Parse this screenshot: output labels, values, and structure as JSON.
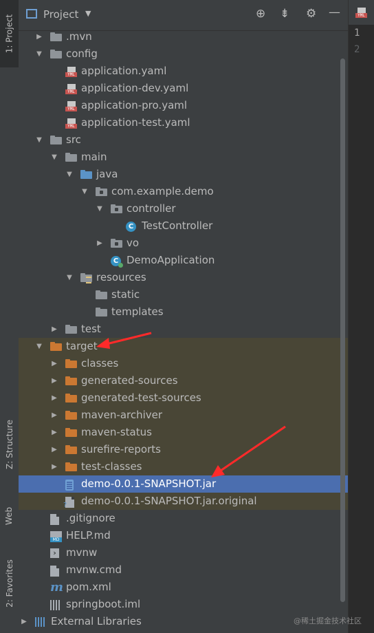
{
  "sidebar": {
    "project_tab": "1: Project",
    "structure_tab": "Z: Structure",
    "web_tab": "Web",
    "favorites_tab": "2: Favorites"
  },
  "header": {
    "title": "Project"
  },
  "tree": [
    {
      "label": ".mvn",
      "depth": 0,
      "arrow": "right",
      "icon": "folder-grey"
    },
    {
      "label": "config",
      "depth": 0,
      "arrow": "down",
      "icon": "folder-grey"
    },
    {
      "label": "application.yaml",
      "depth": 1,
      "arrow": "",
      "icon": "yaml-file"
    },
    {
      "label": "application-dev.yaml",
      "depth": 1,
      "arrow": "",
      "icon": "yaml-file"
    },
    {
      "label": "application-pro.yaml",
      "depth": 1,
      "arrow": "",
      "icon": "yaml-file"
    },
    {
      "label": "application-test.yaml",
      "depth": 1,
      "arrow": "",
      "icon": "yaml-file"
    },
    {
      "label": "src",
      "depth": 0,
      "arrow": "down",
      "icon": "folder-grey"
    },
    {
      "label": "main",
      "depth": 1,
      "arrow": "down",
      "icon": "folder-grey"
    },
    {
      "label": "java",
      "depth": 2,
      "arrow": "down",
      "icon": "folder-blue"
    },
    {
      "label": "com.example.demo",
      "depth": 3,
      "arrow": "down",
      "icon": "package"
    },
    {
      "label": "controller",
      "depth": 4,
      "arrow": "down",
      "icon": "package"
    },
    {
      "label": "TestController",
      "depth": 5,
      "arrow": "",
      "icon": "class"
    },
    {
      "label": "vo",
      "depth": 4,
      "arrow": "right",
      "icon": "package"
    },
    {
      "label": "DemoApplication",
      "depth": 4,
      "arrow": "",
      "icon": "spring-class"
    },
    {
      "label": "resources",
      "depth": 2,
      "arrow": "down",
      "icon": "resources-folder"
    },
    {
      "label": "static",
      "depth": 3,
      "arrow": "",
      "icon": "folder-grey"
    },
    {
      "label": "templates",
      "depth": 3,
      "arrow": "",
      "icon": "folder-grey"
    },
    {
      "label": "test",
      "depth": 1,
      "arrow": "right",
      "icon": "folder-grey"
    },
    {
      "label": "target",
      "depth": 0,
      "arrow": "down",
      "icon": "folder-orange",
      "state": "highlight"
    },
    {
      "label": "classes",
      "depth": 1,
      "arrow": "right",
      "icon": "folder-orange",
      "state": "highlight"
    },
    {
      "label": "generated-sources",
      "depth": 1,
      "arrow": "right",
      "icon": "folder-orange",
      "state": "highlight"
    },
    {
      "label": "generated-test-sources",
      "depth": 1,
      "arrow": "right",
      "icon": "folder-orange",
      "state": "highlight"
    },
    {
      "label": "maven-archiver",
      "depth": 1,
      "arrow": "right",
      "icon": "folder-orange",
      "state": "highlight"
    },
    {
      "label": "maven-status",
      "depth": 1,
      "arrow": "right",
      "icon": "folder-orange",
      "state": "highlight"
    },
    {
      "label": "surefire-reports",
      "depth": 1,
      "arrow": "right",
      "icon": "folder-orange",
      "state": "highlight"
    },
    {
      "label": "test-classes",
      "depth": 1,
      "arrow": "right",
      "icon": "folder-orange",
      "state": "highlight"
    },
    {
      "label": "demo-0.0.1-SNAPSHOT.jar",
      "depth": 1,
      "arrow": "",
      "icon": "jar-file",
      "state": "selected"
    },
    {
      "label": "demo-0.0.1-SNAPSHOT.jar.original",
      "depth": 1,
      "arrow": "",
      "icon": "unknown-file",
      "state": "highlight"
    },
    {
      "label": ".gitignore",
      "depth": 0,
      "arrow": "",
      "icon": "text-file"
    },
    {
      "label": "HELP.md",
      "depth": 0,
      "arrow": "",
      "icon": "markdown-file"
    },
    {
      "label": "mvnw",
      "depth": 0,
      "arrow": "",
      "icon": "terminal-file"
    },
    {
      "label": "mvnw.cmd",
      "depth": 0,
      "arrow": "",
      "icon": "text-file"
    },
    {
      "label": "pom.xml",
      "depth": 0,
      "arrow": "",
      "icon": "maven-file"
    },
    {
      "label": "springboot.iml",
      "depth": 0,
      "arrow": "",
      "icon": "iml-file"
    },
    {
      "label": "External Libraries",
      "depth": -1,
      "arrow": "right",
      "icon": "libraries"
    }
  ],
  "editor": {
    "tab_icon": "YML",
    "line_numbers": [
      "1",
      "2"
    ]
  },
  "watermark": "@稀土掘金技术社区",
  "colors": {
    "highlight": "#494636",
    "selected": "#4b6eaf",
    "annotation_arrow": "#ff2a2a"
  }
}
